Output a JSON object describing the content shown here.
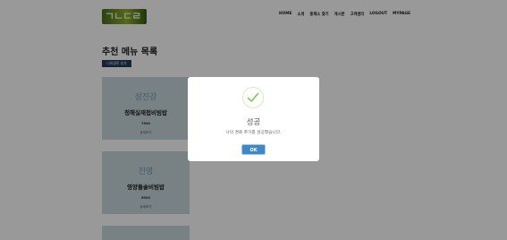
{
  "header": {
    "logo_text": "ㄱㄴㄷㄹ",
    "nav": [
      "HOME",
      "소개",
      "홍제소 찾기",
      "게시판",
      "고객센터",
      "LOGOUT",
      "MYPAGE"
    ]
  },
  "main": {
    "title": "추천 메뉴 목록",
    "my_route_button": "나의경로 추가",
    "cards": [
      {
        "name": "성진강",
        "menu": "청해실재첩비빔밥",
        "price": "7000",
        "action": "상세보기"
      },
      {
        "name": "진영",
        "menu": "영양돌솥비빔밥",
        "price": "6000",
        "action": "상세보기"
      }
    ]
  },
  "modal": {
    "icon": "check-icon",
    "title": "성공",
    "message": "나의 경로 추가를 성공했습니다.",
    "ok_label": "OK",
    "accent_color": "#3f87c6",
    "check_color": "#8dcf5f"
  }
}
